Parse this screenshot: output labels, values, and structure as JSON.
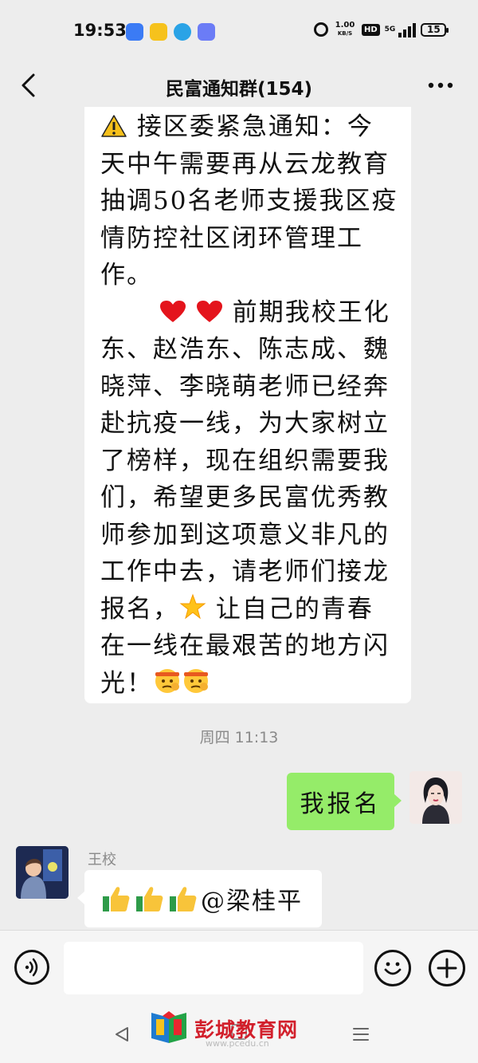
{
  "status_bar": {
    "time": "19:53",
    "net_speed_value": "1.00",
    "net_speed_unit": "KB/S",
    "hd": "HD",
    "net_type": "5G",
    "battery": "15"
  },
  "header": {
    "title": "民富通知群(154)"
  },
  "messages": {
    "announcement": {
      "part1": " 接区委紧急通知：今天中午需要再从云龙教育抽调50名老师支援我区疫情防控社区闭环管理工作。",
      "part2": " 前期我校王化东、赵浩东、陈志成、魏晓萍、李晓萌老师已经奔赴抗疫一线，为大家树立了榜样，现在组织需要我们，希望更多民富优秀教师参加到这项意义非凡的工作中去，请老师们接龙报名，",
      "part3": " 让自己的青春在一线在最艰苦的地方闪光！"
    },
    "timestamp": "周四 11:13",
    "my_message": "我报名",
    "other_sender": "王校",
    "other_message": "@梁桂平"
  },
  "watermark": {
    "brand": "彭城教育网",
    "url": "www.pcedu.cn"
  },
  "colors": {
    "background": "#ededed",
    "my_bubble": "#95ec69",
    "watermark_red": "#d21f2b"
  },
  "icons": [
    "back-icon",
    "more-icon",
    "warning-icon",
    "heart-icon",
    "star-icon",
    "salute-face-icon",
    "thumbs-up-icon",
    "voice-icon",
    "emoji-icon",
    "plus-icon"
  ]
}
